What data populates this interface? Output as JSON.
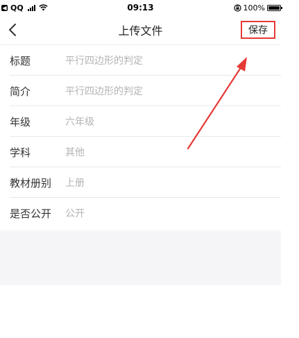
{
  "status_bar": {
    "carrier": "QQ",
    "time": "09:13",
    "battery": "100%",
    "battery_level": 1.0
  },
  "nav": {
    "title": "上传文件",
    "save_label": "保存",
    "back_icon": "chevron-left-icon"
  },
  "form": {
    "rows": [
      {
        "label": "标题",
        "value": "平行四边形的判定"
      },
      {
        "label": "简介",
        "value": "平行四边形的判定"
      },
      {
        "label": "年级",
        "value": "六年级"
      },
      {
        "label": "学科",
        "value": "其他"
      },
      {
        "label": "教材册别",
        "value": "上册"
      },
      {
        "label": "是否公开",
        "value": "公开"
      }
    ]
  },
  "annotation": {
    "color": "#e53935"
  }
}
